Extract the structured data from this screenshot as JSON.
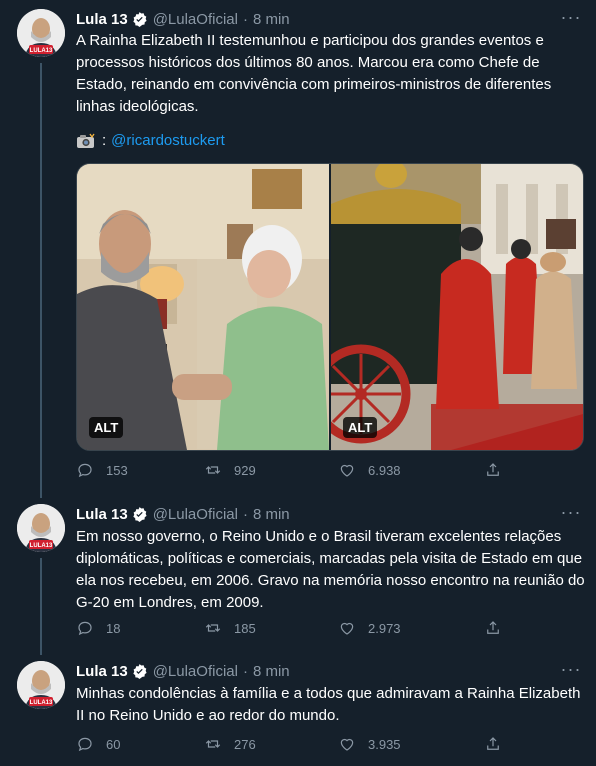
{
  "tweets": [
    {
      "author_name": "Lula 13",
      "handle": "@LulaOficial",
      "separator": "·",
      "time": "8 min",
      "text": "A Rainha Elizabeth II testemunhou e participou dos grandes eventos e processos históricos dos últimos 80 anos. Marcou era como Chefe de Estado, reinando em convivência com primeiros-ministros de diferentes linhas ideológicas.",
      "photo_credit_prefix": ":",
      "photo_credit_handle": "@ricardostuckert",
      "media_alt_labels": [
        "ALT",
        "ALT"
      ],
      "replies": "153",
      "retweets": "929",
      "likes": "6.938"
    },
    {
      "author_name": "Lula 13",
      "handle": "@LulaOficial",
      "separator": "·",
      "time": "8 min",
      "text": "Em nosso governo, o Reino Unido e o Brasil tiveram excelentes relações diplomáticas, políticas e comerciais, marcadas pela visita de Estado em que ela nos recebeu, em 2006. Gravo na memória nosso encontro na reunião do G-20 em Londres, em 2009.",
      "replies": "18",
      "retweets": "185",
      "likes": "2.973"
    },
    {
      "author_name": "Lula 13",
      "handle": "@LulaOficial",
      "separator": "·",
      "time": "8 min",
      "text": "Minhas condolências à família e a todos que admiravam a Rainha Elizabeth II no Reino Unido e ao redor do mundo.",
      "replies": "60",
      "retweets": "276",
      "likes": "3.935"
    }
  ],
  "avatar_badge": "LULA13",
  "icons": {
    "verified": "verified-badge-icon",
    "more": "more-options-icon",
    "reply": "reply-icon",
    "retweet": "retweet-icon",
    "like": "like-icon",
    "share": "share-icon",
    "camera": "camera-icon"
  },
  "colors": {
    "background": "#15202b",
    "accent": "#1d9bf0",
    "muted_text": "#8b98a5",
    "divider": "#38444d"
  }
}
